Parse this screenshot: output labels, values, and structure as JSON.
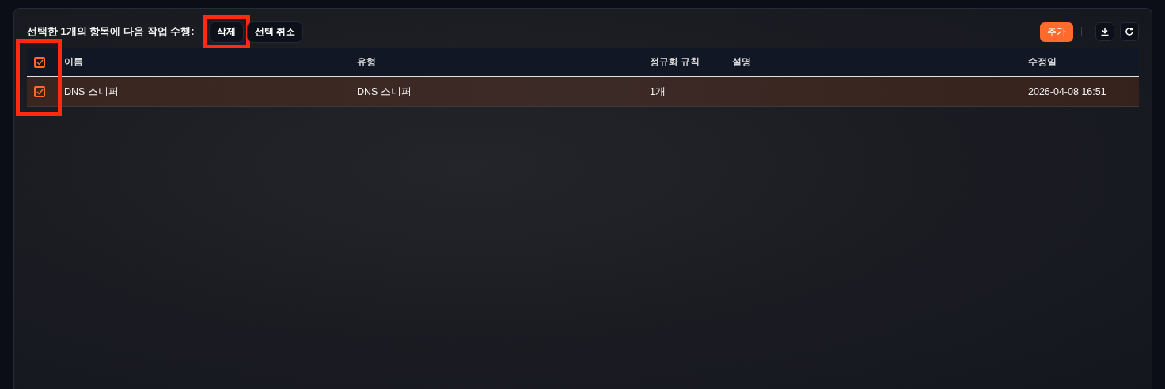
{
  "selection_bar": {
    "message": "선택한 1개의 항목에 다음 작업 수행:",
    "actions": [
      {
        "label": "삭제",
        "highlighted": true
      },
      {
        "label": "선택 취소",
        "highlighted": false
      }
    ]
  },
  "toolbar": {
    "add_label": "추가"
  },
  "table": {
    "checkbox_column_highlighted": true,
    "all_checked": true,
    "columns": [
      "이름",
      "유형",
      "정규화 규칙",
      "설명",
      "수정일"
    ],
    "rows": [
      {
        "checked": true,
        "cells": [
          "DNS 스니퍼",
          "DNS 스니퍼",
          "1개",
          "",
          "2026-04-08 16:51"
        ]
      }
    ]
  }
}
